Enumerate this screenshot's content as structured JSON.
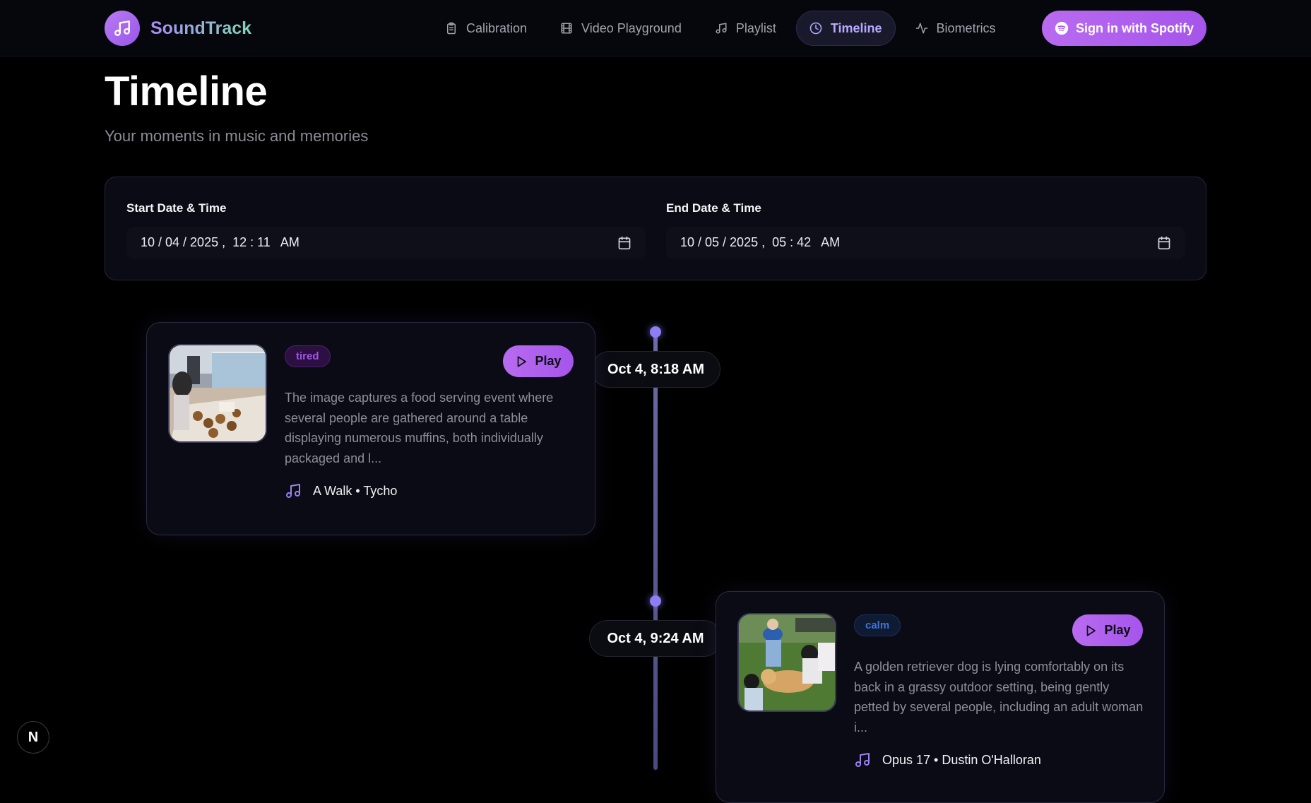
{
  "app": {
    "name": "SoundTrack",
    "brand_gradient": [
      "#a98bf5",
      "#7fd6b4"
    ],
    "accent": "#a555ea"
  },
  "nav": {
    "items": [
      {
        "label": "Calibration",
        "icon": "clipboard-icon"
      },
      {
        "label": "Video Playground",
        "icon": "film-icon"
      },
      {
        "label": "Playlist",
        "icon": "music-note-icon"
      },
      {
        "label": "Timeline",
        "icon": "clock-icon",
        "active": true
      },
      {
        "label": "Biometrics",
        "icon": "activity-icon"
      }
    ],
    "spotify_label": "Sign in with Spotify"
  },
  "header": {
    "title": "Timeline",
    "subtitle": "Your moments in music and memories"
  },
  "filters": {
    "start": {
      "label": "Start Date & Time",
      "value": "10 / 04 / 2025 ,  12 : 11   AM"
    },
    "end": {
      "label": "End Date & Time",
      "value": "10 / 05 / 2025 ,  05 : 42   AM"
    }
  },
  "timeline": {
    "entries": [
      {
        "time": "Oct 4, 8:18 AM",
        "mood": "tired",
        "play_label": "Play",
        "description": "The image captures a food serving event where several people are gathered around a table displaying numerous muffins, both individually packaged and l...",
        "song": "A Walk • Tycho",
        "image": "food-serving-event-photo"
      },
      {
        "time": "Oct 4, 9:24 AM",
        "mood": "calm",
        "play_label": "Play",
        "description": "A golden retriever dog is lying comfortably on its back in a grassy outdoor setting, being gently petted by several people, including an adult woman i...",
        "song": "Opus 17 • Dustin O'Halloran",
        "image": "golden-retriever-petting-photo"
      }
    ]
  },
  "dev_badge": "N"
}
